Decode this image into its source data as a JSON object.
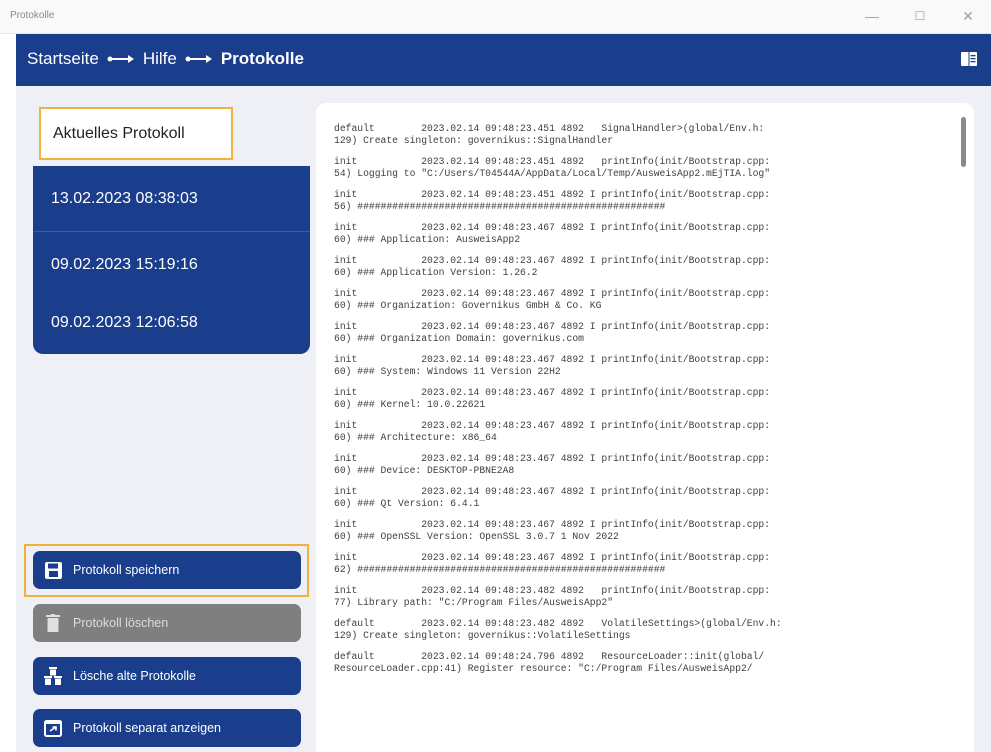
{
  "window": {
    "title": "Protokolle",
    "controls": {
      "minimize": "—",
      "maximize": "☐",
      "close": "✕"
    }
  },
  "nav": {
    "breadcrumbs": [
      "Startseite",
      "Hilfe",
      "Protokolle"
    ],
    "separator_icon": "arrow-right-icon",
    "menu_icon": "book-icon"
  },
  "logs": {
    "current": "Aktuelles Protokoll",
    "entries": [
      "13.02.2023 08:38:03",
      "09.02.2023 15:19:16",
      "09.02.2023 12:06:58"
    ]
  },
  "actions": {
    "save": "Protokoll speichern",
    "delete": "Protokoll löschen",
    "delete_old": "Lösche alte Protokolle",
    "show_separate": "Protokoll separat anzeigen"
  },
  "log_text": [
    [
      "default        2023.02.14 09:48:23.451 4892   SignalHandler>(global/Env.h:",
      "129) Create singleton: governikus::SignalHandler"
    ],
    [
      "init           2023.02.14 09:48:23.451 4892   printInfo(init/Bootstrap.cpp:",
      "54) Logging to \"C:/Users/T04544A/AppData/Local/Temp/AusweisApp2.mEjTIA.log\""
    ],
    [
      "init           2023.02.14 09:48:23.451 4892 I printInfo(init/Bootstrap.cpp:",
      "56) #####################################################"
    ],
    [
      "init           2023.02.14 09:48:23.467 4892 I printInfo(init/Bootstrap.cpp:",
      "60) ### Application: AusweisApp2"
    ],
    [
      "init           2023.02.14 09:48:23.467 4892 I printInfo(init/Bootstrap.cpp:",
      "60) ### Application Version: 1.26.2"
    ],
    [
      "init           2023.02.14 09:48:23.467 4892 I printInfo(init/Bootstrap.cpp:",
      "60) ### Organization: Governikus GmbH & Co. KG"
    ],
    [
      "init           2023.02.14 09:48:23.467 4892 I printInfo(init/Bootstrap.cpp:",
      "60) ### Organization Domain: governikus.com"
    ],
    [
      "init           2023.02.14 09:48:23.467 4892 I printInfo(init/Bootstrap.cpp:",
      "60) ### System: Windows 11 Version 22H2"
    ],
    [
      "init           2023.02.14 09:48:23.467 4892 I printInfo(init/Bootstrap.cpp:",
      "60) ### Kernel: 10.0.22621"
    ],
    [
      "init           2023.02.14 09:48:23.467 4892 I printInfo(init/Bootstrap.cpp:",
      "60) ### Architecture: x86_64"
    ],
    [
      "init           2023.02.14 09:48:23.467 4892 I printInfo(init/Bootstrap.cpp:",
      "60) ### Device: DESKTOP-PBNE2A8"
    ],
    [
      "init           2023.02.14 09:48:23.467 4892 I printInfo(init/Bootstrap.cpp:",
      "60) ### Qt Version: 6.4.1"
    ],
    [
      "init           2023.02.14 09:48:23.467 4892 I printInfo(init/Bootstrap.cpp:",
      "60) ### OpenSSL Version: OpenSSL 3.0.7 1 Nov 2022"
    ],
    [
      "init           2023.02.14 09:48:23.467 4892 I printInfo(init/Bootstrap.cpp:",
      "62) #####################################################"
    ],
    [
      "init           2023.02.14 09:48:23.482 4892   printInfo(init/Bootstrap.cpp:",
      "77) Library path: \"C:/Program Files/AusweisApp2\""
    ],
    [
      "default        2023.02.14 09:48:23.482 4892   VolatileSettings>(global/Env.h:",
      "129) Create singleton: governikus::VolatileSettings"
    ],
    [
      "default        2023.02.14 09:48:24.796 4892   ResourceLoader::init(global/",
      "ResourceLoader.cpp:41) Register resource: \"C:/Program Files/AusweisApp2/"
    ]
  ]
}
